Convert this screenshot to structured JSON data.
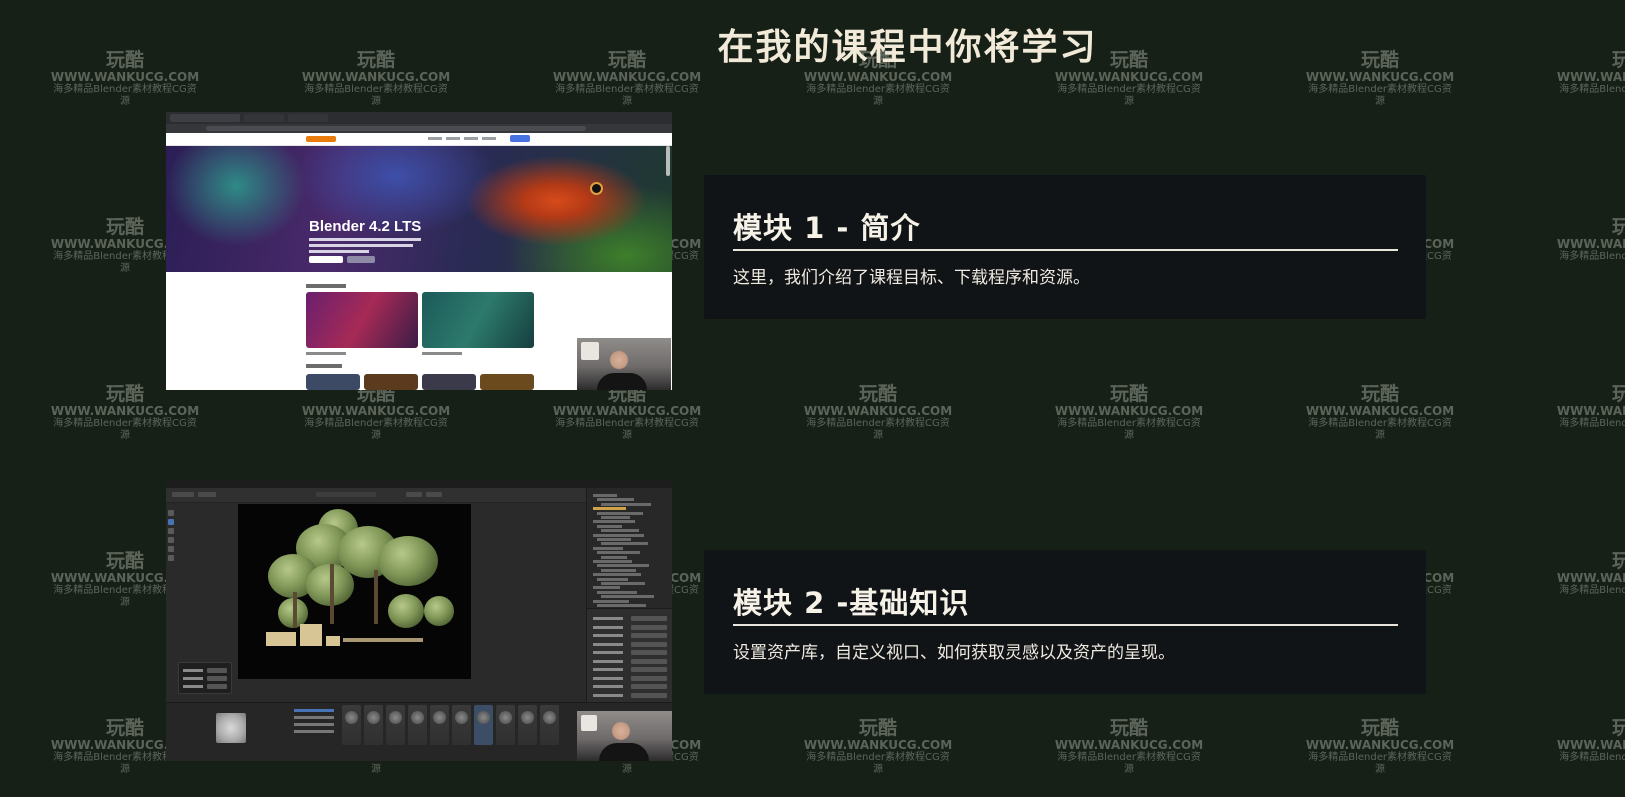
{
  "page": {
    "title": "在我的课程中你将学习"
  },
  "modules": [
    {
      "title": "模块 1 - 简介",
      "description": "这里，我们介绍了课程目标、下载程序和资源。"
    },
    {
      "title": "模块 2 -基础知识",
      "description": "设置资产库，自定义视口、如何获取灵感以及资产的呈现。"
    }
  ],
  "screenshot_1": {
    "hero_title": "Blender 4.2 LTS"
  },
  "watermark": {
    "logo": "玩酷",
    "url": "WWW.WANKUCG.COM",
    "sub": "海多精品Blender素材教程CG资源"
  },
  "colors": {
    "background": "#162016",
    "card": "#111417",
    "title": "#f1ead8"
  }
}
